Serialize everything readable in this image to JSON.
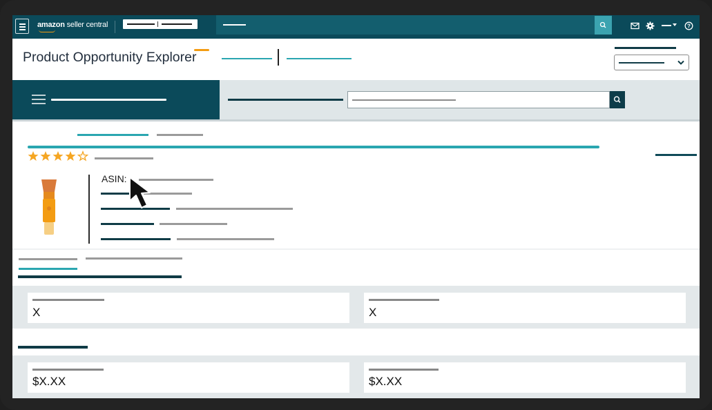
{
  "app": {
    "logo_brand": "amazon",
    "logo_product": "seller central"
  },
  "header": {
    "title": "Product Opportunity Explorer"
  },
  "product": {
    "rating_stars": 4,
    "rating_max": 5,
    "asin_label": "ASIN:"
  },
  "metrics": {
    "row1": [
      {
        "value": "X"
      },
      {
        "value": "X"
      }
    ],
    "row2": [
      {
        "value": "$X.XX"
      },
      {
        "value": "$X.XX"
      }
    ]
  },
  "colors": {
    "nav_bg": "#0b4a5a",
    "accent_teal": "#2aa6b0",
    "accent_orange": "#f39c12",
    "star": "#f5a623"
  },
  "icons": {
    "menu": "hamburger-icon",
    "search": "search-icon",
    "mail": "mail-icon",
    "settings": "gear-icon",
    "help": "help-icon",
    "dropdown": "chevron-down-icon",
    "pointer": "cursor-arrow-icon"
  }
}
